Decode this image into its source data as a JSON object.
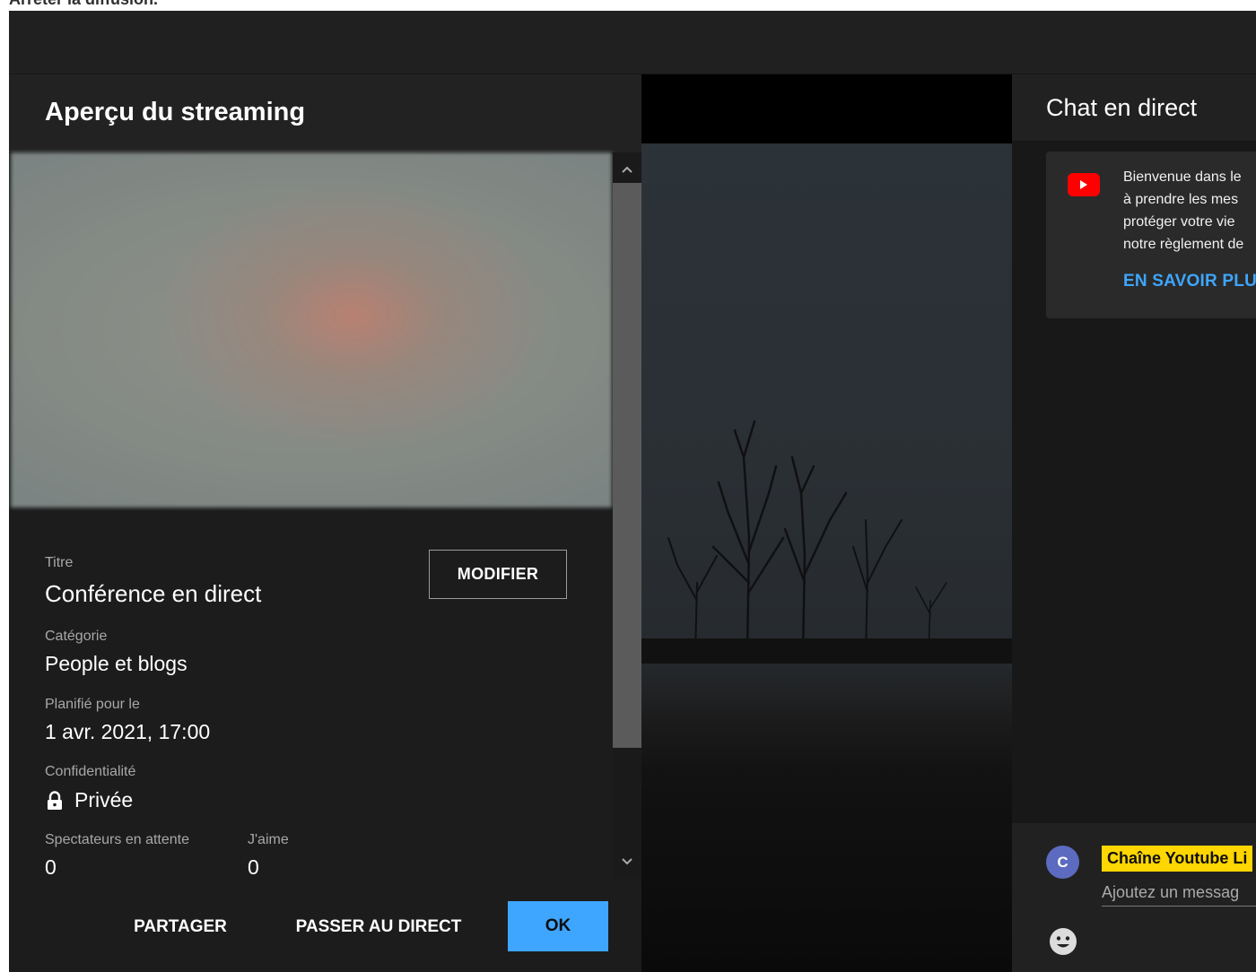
{
  "page": {
    "caption": "Arrêter la diffusion."
  },
  "preview": {
    "title": "Aperçu du streaming",
    "fields": {
      "title_label": "Titre",
      "title_value": "Conférence en direct",
      "category_label": "Catégorie",
      "category_value": "People et blogs",
      "scheduled_label": "Planifié pour le",
      "scheduled_value": "1 avr. 2021, 17:00",
      "privacy_label": "Confidentialité",
      "privacy_value": "Privée",
      "waiting_label": "Spectateurs en attente",
      "waiting_value": "0",
      "likes_label": "J'aime",
      "likes_value": "0"
    },
    "edit_label": "MODIFIER",
    "footer": {
      "share_label": "PARTAGER",
      "go_live_label": "PASSER AU DIRECT",
      "ok_label": "OK"
    }
  },
  "chat": {
    "title": "Chat en direct",
    "welcome_lines": [
      "Bienvenue dans le",
      "à prendre les mes",
      "protéger votre vie",
      "notre règlement de"
    ],
    "learn_more_label": "EN SAVOIR PLU",
    "avatar_letter": "C",
    "channel_name": "Chaîne Youtube Li",
    "input_placeholder": "Ajoutez un messag"
  },
  "colors": {
    "accent_blue": "#3ea6ff",
    "badge_yellow": "#ffd600",
    "youtube_red": "#ff0000",
    "avatar_indigo": "#5c6bc0"
  },
  "icons": [
    "lock-icon",
    "youtube-icon",
    "emoji-icon",
    "chevron-up-icon",
    "chevron-down-icon"
  ]
}
